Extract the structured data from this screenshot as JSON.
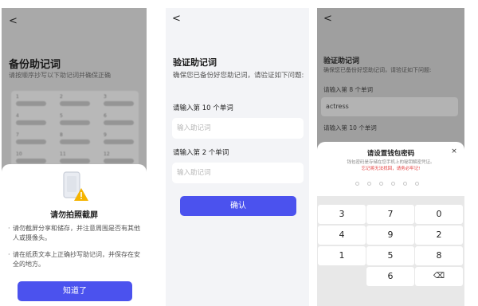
{
  "screen1": {
    "back": "<",
    "title": "备份助记词",
    "subtitle": "请按顺序抄写以下助记词并确保正确",
    "word_numbers": [
      "1",
      "2",
      "3",
      "4",
      "5",
      "6",
      "7",
      "8",
      "9",
      "10",
      "11",
      "12"
    ],
    "modal": {
      "icon": "phone-warning-icon",
      "title": "请勿拍照截屏",
      "bullets": [
        "请勿截屏分享和储存，并注意周围是否有其他人或摄像头。",
        "请在纸质文本上正确抄写助记词，并保存在安全的地方。"
      ],
      "button": "知道了"
    }
  },
  "screen2": {
    "back": "<",
    "title": "验证助记词",
    "subtitle": "确保您已备份好您助记词，请验证如下问题:",
    "q1": "请输入第 10 个单词",
    "q2": "请输入第 2 个单词",
    "placeholder": "输入助记词",
    "button": "确认"
  },
  "screen3": {
    "back": "<",
    "title": "验证助记词",
    "subtitle": "确保您已备份好您助记词，请验证如下问题:",
    "q1": "请输入第 8 个单词",
    "q1_value": "actress",
    "q2": "请输入第 10 个单词",
    "sheet": {
      "title": "请设置钱包密码",
      "close": "×",
      "note": "钱包密码是存储在您手机上的秘钥解密凭证。",
      "warning": "忘记将无法找回，请务必牢记!",
      "keys": [
        "3",
        "7",
        "0",
        "4",
        "9",
        "2",
        "1",
        "5",
        "8",
        "",
        "6",
        "⌫"
      ]
    }
  },
  "colors": {
    "accent": "#4b52ee",
    "warning": "#e33b3b",
    "icon_yellow": "#f5b400"
  }
}
